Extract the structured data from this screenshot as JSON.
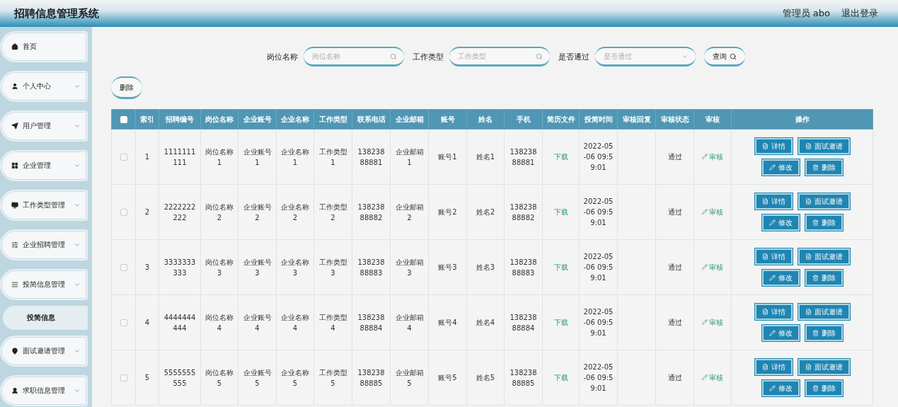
{
  "header": {
    "title": "招聘信息管理系统",
    "user": "管理员 abo",
    "logout": "退出登录"
  },
  "sidebar": {
    "items": [
      {
        "label": "首页",
        "kind": "link"
      },
      {
        "label": "个人中心",
        "kind": "menu"
      },
      {
        "label": "用户管理",
        "kind": "menu"
      },
      {
        "label": "企业管理",
        "kind": "menu"
      },
      {
        "label": "工作类型管理",
        "kind": "menu"
      },
      {
        "label": "企业招聘管理",
        "kind": "menu"
      },
      {
        "label": "投简信息管理",
        "kind": "menu",
        "children": [
          {
            "label": "投简信息",
            "selected": true
          }
        ]
      },
      {
        "label": "面试邀请管理",
        "kind": "menu"
      },
      {
        "label": "求职信息管理",
        "kind": "menu"
      }
    ]
  },
  "filters": [
    {
      "label": "岗位名称",
      "placeholder": "岗位名称",
      "kind": "search"
    },
    {
      "label": "工作类型",
      "placeholder": "工作类型",
      "kind": "search"
    },
    {
      "label": "是否通过",
      "placeholder": "是否通过",
      "kind": "select"
    }
  ],
  "query_button": "查询",
  "delete_button": "删除",
  "table": {
    "select_all": {
      "checked": false
    },
    "columns": [
      "索引",
      "招聘编号",
      "岗位名称",
      "企业账号",
      "企业名称",
      "工作类型",
      "联系电话",
      "企业邮箱",
      "账号",
      "姓名",
      "手机",
      "简历文件",
      "投简时间",
      "审核回复",
      "审核状态",
      "审核",
      "操作"
    ],
    "rows": [
      {
        "checked": false,
        "cells": [
          {
            "kind": "text",
            "text": "1"
          },
          {
            "kind": "text",
            "text": "1111111111"
          },
          {
            "kind": "text",
            "text": "岗位名称1"
          },
          {
            "kind": "text",
            "text": "企业账号1"
          },
          {
            "kind": "text",
            "text": "企业名称1"
          },
          {
            "kind": "text",
            "text": "工作类型1"
          },
          {
            "kind": "text",
            "text": "13823888881"
          },
          {
            "kind": "text",
            "text": "企业邮箱1"
          },
          {
            "kind": "text",
            "text": "账号1"
          },
          {
            "kind": "text",
            "text": "姓名1"
          },
          {
            "kind": "text",
            "text": "13823888881"
          },
          {
            "kind": "download",
            "text": "下载"
          },
          {
            "kind": "text",
            "text": "2022-05-06 09:59:01"
          },
          {
            "kind": "blank"
          },
          {
            "kind": "text",
            "text": "通过"
          },
          {
            "kind": "review",
            "text": "审核"
          }
        ],
        "actions": [
          {
            "kind": "detail",
            "label": "详情"
          },
          {
            "kind": "invite",
            "label": "面试邀请"
          },
          {
            "kind": "edit",
            "label": "修改"
          },
          {
            "kind": "delete",
            "label": "删除"
          }
        ]
      },
      {
        "checked": false,
        "cells": [
          {
            "kind": "text",
            "text": "2"
          },
          {
            "kind": "text",
            "text": "2222222222"
          },
          {
            "kind": "text",
            "text": "岗位名称2"
          },
          {
            "kind": "text",
            "text": "企业账号2"
          },
          {
            "kind": "text",
            "text": "企业名称2"
          },
          {
            "kind": "text",
            "text": "工作类型2"
          },
          {
            "kind": "text",
            "text": "13823888882"
          },
          {
            "kind": "text",
            "text": "企业邮箱2"
          },
          {
            "kind": "text",
            "text": "账号2"
          },
          {
            "kind": "text",
            "text": "姓名2"
          },
          {
            "kind": "text",
            "text": "13823888882"
          },
          {
            "kind": "download",
            "text": "下载"
          },
          {
            "kind": "text",
            "text": "2022-05-06 09:59:01"
          },
          {
            "kind": "blank"
          },
          {
            "kind": "text",
            "text": "通过"
          },
          {
            "kind": "review",
            "text": "审核"
          }
        ],
        "actions": [
          {
            "kind": "detail",
            "label": "详情"
          },
          {
            "kind": "invite",
            "label": "面试邀请"
          },
          {
            "kind": "edit",
            "label": "修改"
          },
          {
            "kind": "delete",
            "label": "删除"
          }
        ]
      },
      {
        "checked": false,
        "cells": [
          {
            "kind": "text",
            "text": "3"
          },
          {
            "kind": "text",
            "text": "3333333333"
          },
          {
            "kind": "text",
            "text": "岗位名称3"
          },
          {
            "kind": "text",
            "text": "企业账号3"
          },
          {
            "kind": "text",
            "text": "企业名称3"
          },
          {
            "kind": "text",
            "text": "工作类型3"
          },
          {
            "kind": "text",
            "text": "13823888883"
          },
          {
            "kind": "text",
            "text": "企业邮箱3"
          },
          {
            "kind": "text",
            "text": "账号3"
          },
          {
            "kind": "text",
            "text": "姓名3"
          },
          {
            "kind": "text",
            "text": "13823888883"
          },
          {
            "kind": "download",
            "text": "下载"
          },
          {
            "kind": "text",
            "text": "2022-05-06 09:59:01"
          },
          {
            "kind": "blank"
          },
          {
            "kind": "text",
            "text": "通过"
          },
          {
            "kind": "review",
            "text": "审核"
          }
        ],
        "actions": [
          {
            "kind": "detail",
            "label": "详情"
          },
          {
            "kind": "invite",
            "label": "面试邀请"
          },
          {
            "kind": "edit",
            "label": "修改"
          },
          {
            "kind": "delete",
            "label": "删除"
          }
        ]
      },
      {
        "checked": false,
        "cells": [
          {
            "kind": "text",
            "text": "4"
          },
          {
            "kind": "text",
            "text": "4444444444"
          },
          {
            "kind": "text",
            "text": "岗位名称4"
          },
          {
            "kind": "text",
            "text": "企业账号4"
          },
          {
            "kind": "text",
            "text": "企业名称4"
          },
          {
            "kind": "text",
            "text": "工作类型4"
          },
          {
            "kind": "text",
            "text": "13823888884"
          },
          {
            "kind": "text",
            "text": "企业邮箱4"
          },
          {
            "kind": "text",
            "text": "账号4"
          },
          {
            "kind": "text",
            "text": "姓名4"
          },
          {
            "kind": "text",
            "text": "13823888884"
          },
          {
            "kind": "download",
            "text": "下载"
          },
          {
            "kind": "text",
            "text": "2022-05-06 09:59:01"
          },
          {
            "kind": "blank"
          },
          {
            "kind": "text",
            "text": "通过"
          },
          {
            "kind": "review",
            "text": "审核"
          }
        ],
        "actions": [
          {
            "kind": "detail",
            "label": "详情"
          },
          {
            "kind": "invite",
            "label": "面试邀请"
          },
          {
            "kind": "edit",
            "label": "修改"
          },
          {
            "kind": "delete",
            "label": "删除"
          }
        ]
      },
      {
        "checked": false,
        "cells": [
          {
            "kind": "text",
            "text": "5"
          },
          {
            "kind": "text",
            "text": "5555555555"
          },
          {
            "kind": "text",
            "text": "岗位名称5"
          },
          {
            "kind": "text",
            "text": "企业账号5"
          },
          {
            "kind": "text",
            "text": "企业名称5"
          },
          {
            "kind": "text",
            "text": "工作类型5"
          },
          {
            "kind": "text",
            "text": "13823888885"
          },
          {
            "kind": "text",
            "text": "企业邮箱5"
          },
          {
            "kind": "text",
            "text": "账号5"
          },
          {
            "kind": "text",
            "text": "姓名5"
          },
          {
            "kind": "text",
            "text": "13823888885"
          },
          {
            "kind": "download",
            "text": "下载"
          },
          {
            "kind": "text",
            "text": "2022-05-06 09:59:01"
          },
          {
            "kind": "blank"
          },
          {
            "kind": "text",
            "text": "通过"
          },
          {
            "kind": "review",
            "text": "审核"
          }
        ],
        "actions": [
          {
            "kind": "detail",
            "label": "详情"
          },
          {
            "kind": "invite",
            "label": "面试邀请"
          },
          {
            "kind": "edit",
            "label": "修改"
          },
          {
            "kind": "delete",
            "label": "删除"
          }
        ]
      }
    ]
  }
}
